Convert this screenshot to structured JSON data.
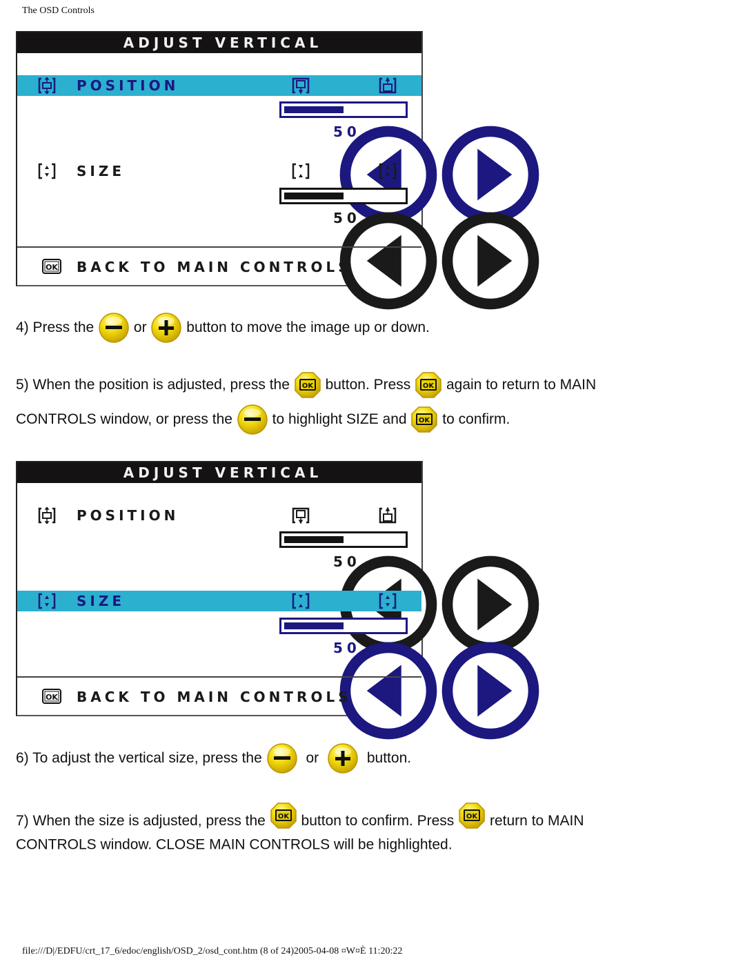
{
  "header": {
    "title": "The OSD Controls"
  },
  "osd_panels": [
    {
      "title": "ADJUST VERTICAL",
      "highlighted": "position",
      "position": {
        "label": "POSITION",
        "value": "50",
        "level": 0.5
      },
      "size": {
        "label": "SIZE",
        "value": "50",
        "level": 0.5
      },
      "back": {
        "label": "BACK TO MAIN CONTROLS"
      }
    },
    {
      "title": "ADJUST VERTICAL",
      "highlighted": "size",
      "position": {
        "label": "POSITION",
        "value": "50",
        "level": 0.5
      },
      "size": {
        "label": "SIZE",
        "value": "50",
        "level": 0.5
      },
      "back": {
        "label": "BACK TO MAIN CONTROLS"
      }
    }
  ],
  "steps": {
    "s4": {
      "a": "4) Press the",
      "b": "or",
      "c": "button to move the image up or down."
    },
    "s5": {
      "a": "5) When the position is adjusted, press the",
      "b": "button. Press",
      "c": "again to return to MAIN",
      "d": "CONTROLS window, or press the",
      "e": "to highlight SIZE and",
      "f": "to confirm."
    },
    "s6": {
      "a": "6) To adjust the vertical size, press the",
      "b": "or",
      "c": "button."
    },
    "s7": {
      "a": "7) When the size is adjusted, press the",
      "b": "button to confirm. Press",
      "c": "return to MAIN",
      "d": "CONTROLS window. CLOSE MAIN CONTROLS will be highlighted."
    }
  },
  "footer": {
    "text": "file:///D|/EDFU/crt_17_6/edoc/english/OSD_2/osd_cont.htm (8 of 24)2005-04-08 ¤W¤È 11:20:22"
  },
  "colors": {
    "highlight": "#2cb0cf",
    "active": "#1c1880",
    "title_bar": "#141212",
    "button_yellow": "#f2d600"
  }
}
